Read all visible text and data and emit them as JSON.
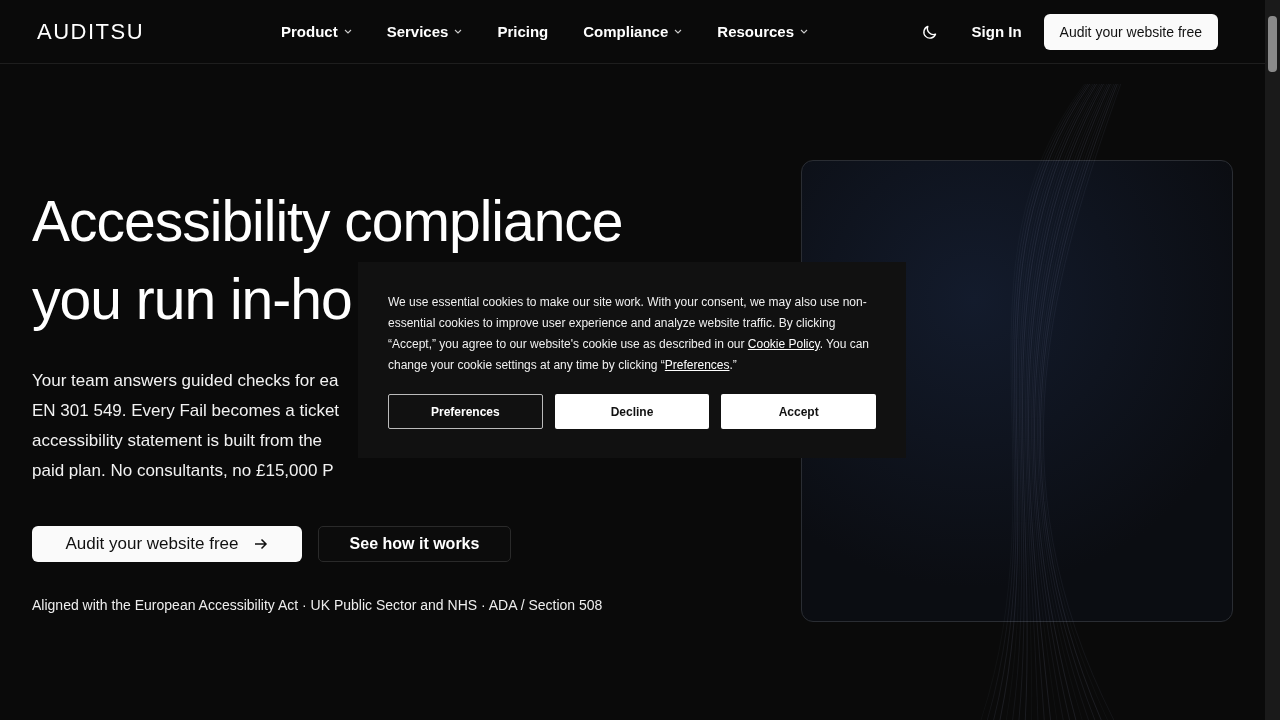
{
  "nav": {
    "logo": "AUDITSU",
    "items": [
      {
        "label": "Product",
        "has_menu": true
      },
      {
        "label": "Services",
        "has_menu": true
      },
      {
        "label": "Pricing",
        "has_menu": false
      },
      {
        "label": "Compliance",
        "has_menu": true
      },
      {
        "label": "Resources",
        "has_menu": true
      }
    ],
    "sign_in": "Sign In",
    "cta": "Audit your website free"
  },
  "hero": {
    "title_lines": [
      "Accessibility compliance",
      "you run in-ho"
    ],
    "body_lines": [
      "Your team answers guided checks for ea",
      "EN 301 549. Every Fail becomes a ticket",
      "accessibility statement is built from the",
      "paid plan. No consultants, no £15,000 P"
    ],
    "primary_button": "Audit your website free",
    "secondary_button": "See how it works",
    "footnote": "Aligned with the European Accessibility Act · UK Public Sector and NHS · ADA / Section 508"
  },
  "cookie_banner": {
    "text": "We use essential cookies to make our site work. With your consent, we may also use non-essential cookies to improve user experience and analyze website traffic. By clicking “Accept,” you agree to our website's cookie use as described in our ",
    "policy_link": "Cookie Policy",
    "text_middle": ". You can change your cookie settings at any time by clicking “",
    "preferences_link": "Preferences",
    "text_end": ".”",
    "buttons": [
      {
        "label": "Preferences",
        "kind": "outline"
      },
      {
        "label": "Decline",
        "kind": "solid"
      },
      {
        "label": "Accept",
        "kind": "solid"
      }
    ]
  }
}
